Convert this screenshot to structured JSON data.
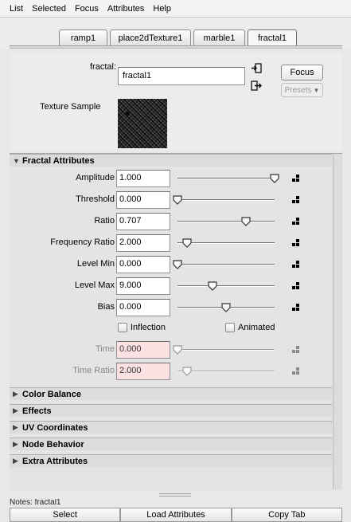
{
  "menu": [
    "List",
    "Selected",
    "Focus",
    "Attributes",
    "Help"
  ],
  "tabs": [
    "ramp1",
    "place2dTexture1",
    "marble1",
    "fractal1"
  ],
  "active_tab": "fractal1",
  "node": {
    "label": "fractal:",
    "name": "fractal1",
    "focus_label": "Focus",
    "presets_label": "Presets",
    "sample_label": "Texture Sample"
  },
  "fractal_section": {
    "title": "Fractal Attributes",
    "attributes": [
      {
        "label": "Amplitude",
        "value": "1.000",
        "slider_fraction": 1.0
      },
      {
        "label": "Threshold",
        "value": "0.000",
        "slider_fraction": 0.0
      },
      {
        "label": "Ratio",
        "value": "0.707",
        "slider_fraction": 0.707
      },
      {
        "label": "Frequency Ratio",
        "value": "2.000",
        "slider_fraction": 0.1
      },
      {
        "label": "Level Min",
        "value": "0.000",
        "slider_fraction": 0.0
      },
      {
        "label": "Level Max",
        "value": "9.000",
        "slider_fraction": 0.36
      },
      {
        "label": "Bias",
        "value": "0.000",
        "slider_fraction": 0.5
      }
    ],
    "inflection_label": "Inflection",
    "animated_label": "Animated",
    "disabled_attributes": [
      {
        "label": "Time",
        "value": "0.000",
        "slider_fraction": 0.0
      },
      {
        "label": "Time Ratio",
        "value": "2.000",
        "slider_fraction": 0.1
      }
    ]
  },
  "collapsed_sections": [
    "Color Balance",
    "Effects",
    "UV Coordinates",
    "Node Behavior",
    "Extra Attributes"
  ],
  "notes_label": "Notes: fractal1",
  "bottom_buttons": [
    "Select",
    "Load Attributes",
    "Copy Tab"
  ]
}
